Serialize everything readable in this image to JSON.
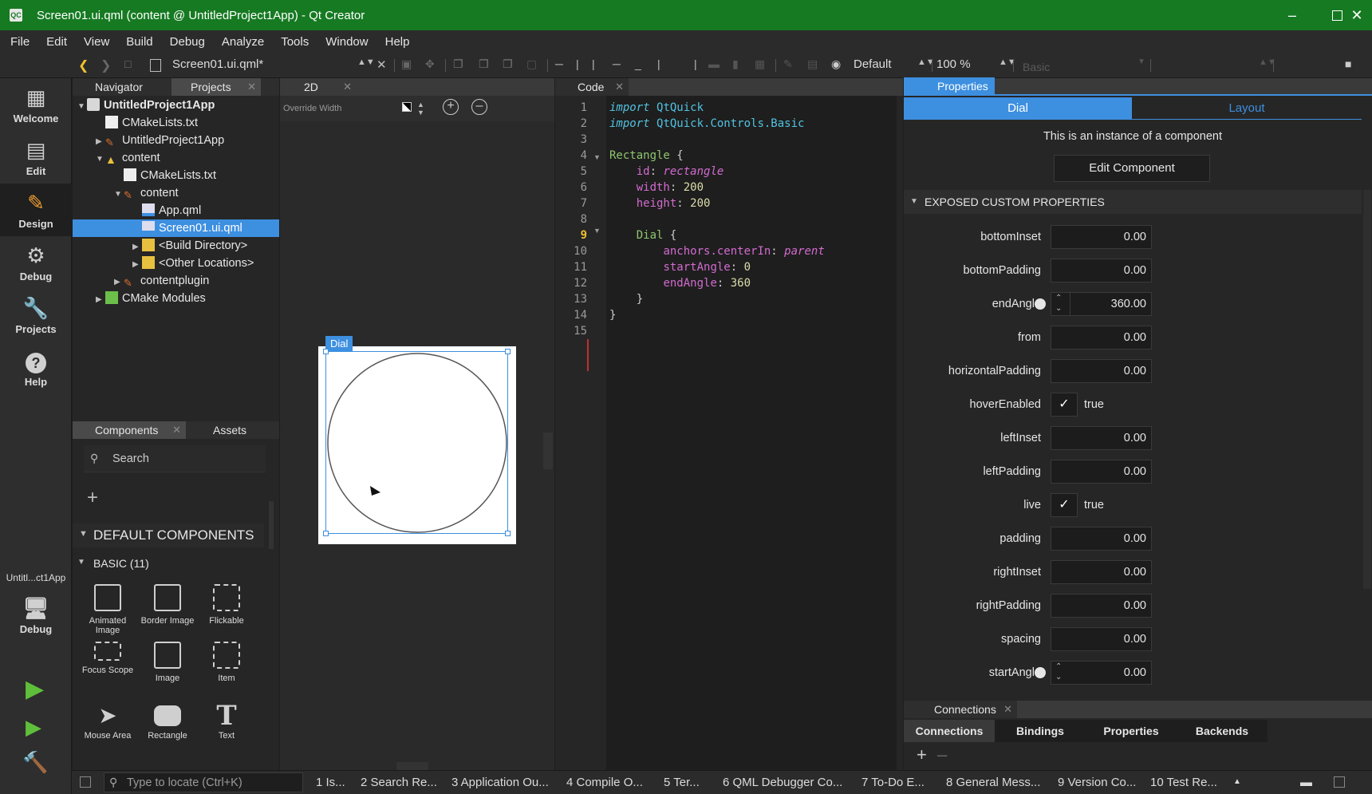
{
  "window": {
    "title": "Screen01.ui.qml (content @ UntitledProject1App) - Qt Creator",
    "app_icon": "QC"
  },
  "menu": [
    "File",
    "Edit",
    "View",
    "Build",
    "Debug",
    "Analyze",
    "Tools",
    "Window",
    "Help"
  ],
  "toolbar": {
    "document": "Screen01.ui.qml*",
    "style": "Default",
    "zoom": "100 %",
    "theme": "Basic"
  },
  "modes": [
    {
      "label": "Welcome",
      "icon": "grid-icon"
    },
    {
      "label": "Edit",
      "icon": "document-icon"
    },
    {
      "label": "Design",
      "icon": "pencil-icon"
    },
    {
      "label": "Debug",
      "icon": "bug-icon"
    },
    {
      "label": "Projects",
      "icon": "wrench-icon"
    },
    {
      "label": "Help",
      "icon": "help-icon"
    }
  ],
  "kit": {
    "name": "Untitl...ct1App",
    "mode": "Debug"
  },
  "navigator": {
    "tabs": [
      "Navigator",
      "Projects"
    ],
    "tree": [
      {
        "label": "UntitledProject1App",
        "depth": 0,
        "expanded": true,
        "bold": true
      },
      {
        "label": "CMakeLists.txt",
        "depth": 1
      },
      {
        "label": "UntitledProject1App",
        "depth": 1,
        "expanded": false
      },
      {
        "label": "content",
        "depth": 1,
        "expanded": true
      },
      {
        "label": "CMakeLists.txt",
        "depth": 2
      },
      {
        "label": "content",
        "depth": 2,
        "expanded": true
      },
      {
        "label": "App.qml",
        "depth": 3
      },
      {
        "label": "Screen01.ui.qml",
        "depth": 3,
        "selected": true
      },
      {
        "label": "<Build Directory>",
        "depth": 3,
        "expanded": false
      },
      {
        "label": "<Other Locations>",
        "depth": 3,
        "expanded": false
      },
      {
        "label": "contentplugin",
        "depth": 2,
        "expanded": false
      },
      {
        "label": "CMake Modules",
        "depth": 1,
        "expanded": false
      }
    ]
  },
  "components": {
    "tabs": [
      "Components",
      "Assets"
    ],
    "search_placeholder": "Search",
    "section": "DEFAULT COMPONENTS",
    "group": "BASIC (11)",
    "items": [
      "Animated Image",
      "Border Image",
      "Flickable",
      "Focus Scope",
      "Image",
      "Item",
      "Mouse Area",
      "Rectangle",
      "Text"
    ]
  },
  "view2d": {
    "tab": "2D",
    "override_width": "Override Width",
    "selected_label": "Dial"
  },
  "code": {
    "tab": "Code",
    "lines": [
      "import QtQuick",
      "import QtQuick.Controls.Basic",
      "",
      "Rectangle {",
      "    id: rectangle",
      "    width: 200",
      "    height: 200",
      "",
      "    Dial {",
      "        anchors.centerIn: parent",
      "        startAngle: 0",
      "        endAngle: 360",
      "    }",
      "}",
      ""
    ]
  },
  "properties": {
    "tab": "Properties",
    "subtabs": [
      "Dial",
      "Layout"
    ],
    "instance_note": "This is an instance of a component",
    "edit_button": "Edit Component",
    "section": "EXPOSED CUSTOM PROPERTIES",
    "rows": [
      {
        "label": "bottomInset",
        "value": "0.00"
      },
      {
        "label": "bottomPadding",
        "value": "0.00"
      },
      {
        "label": "endAngle",
        "value": "360.00",
        "spin": true
      },
      {
        "label": "from",
        "value": "0.00"
      },
      {
        "label": "horizontalPadding",
        "value": "0.00"
      },
      {
        "label": "hoverEnabled",
        "value": "true",
        "check": true
      },
      {
        "label": "leftInset",
        "value": "0.00"
      },
      {
        "label": "leftPadding",
        "value": "0.00"
      },
      {
        "label": "live",
        "value": "true",
        "check": true
      },
      {
        "label": "padding",
        "value": "0.00"
      },
      {
        "label": "rightInset",
        "value": "0.00"
      },
      {
        "label": "rightPadding",
        "value": "0.00"
      },
      {
        "label": "spacing",
        "value": "0.00"
      },
      {
        "label": "startAngle",
        "value": "0.00",
        "spin": true
      }
    ]
  },
  "connections": {
    "tab": "Connections",
    "subtabs": [
      "Connections",
      "Bindings",
      "Properties",
      "Backends"
    ]
  },
  "status": {
    "locator_placeholder": "Type to locate (Ctrl+K)",
    "panes": [
      "1 Is...",
      "2 Search Re...",
      "3 Application Ou...",
      "4 Compile O...",
      "5 Ter...",
      "6 QML Debugger Co...",
      "7 To-Do E...",
      "8 General Mess...",
      "9 Version Co...",
      "10 Test Re..."
    ]
  },
  "colors": {
    "titlebar": "#167a22",
    "accent": "#3d8fe0",
    "keyword": "#52c2e0",
    "number": "#dcdcaa",
    "property": "#d36bd0",
    "type_green": "#8fc66f"
  }
}
